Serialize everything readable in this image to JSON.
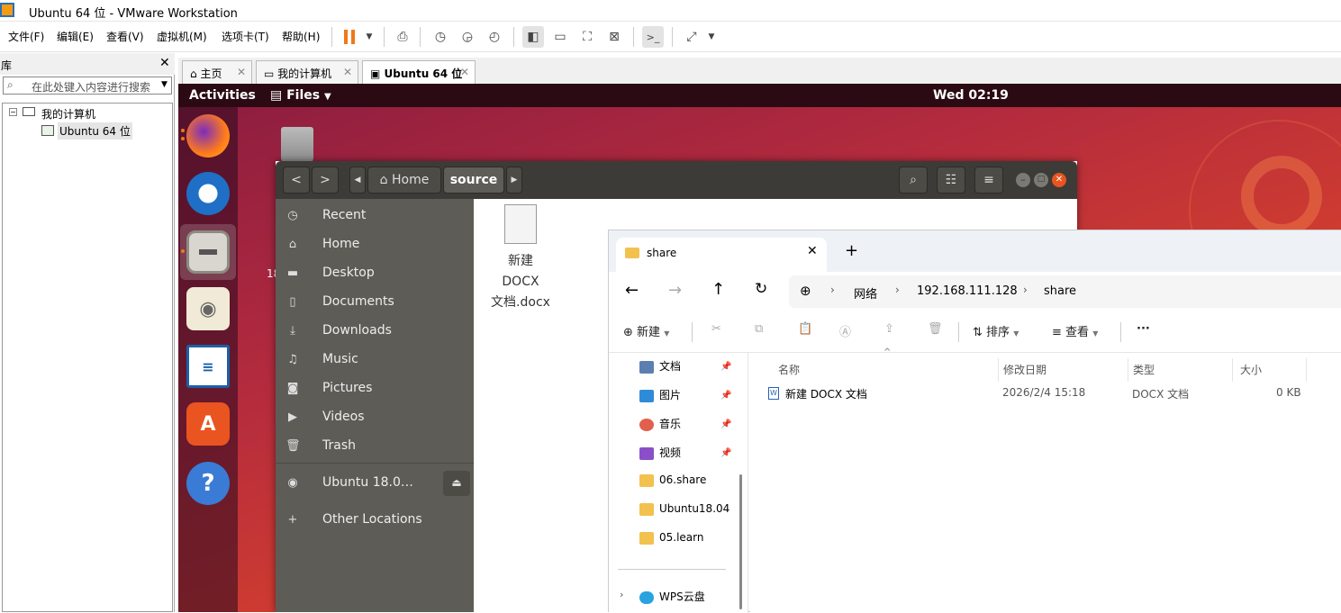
{
  "window": {
    "title": "Ubuntu 64 位 - VMware Workstation"
  },
  "menu": [
    "文件(F)",
    "编辑(E)",
    "查看(V)",
    "虚拟机(M)",
    "选项卡(T)",
    "帮助(H)"
  ],
  "library": {
    "title": "库",
    "search_placeholder": "在此处键入内容进行搜索",
    "tree_root": "我的计算机",
    "tree_child": "Ubuntu 64 位"
  },
  "tabs": [
    {
      "label": "主页"
    },
    {
      "label": "我的计算机"
    },
    {
      "label": "Ubuntu 64 位"
    }
  ],
  "ubuntu": {
    "activities": "Activities",
    "app_menu": "Files",
    "clock": "Wed 02:19",
    "desktop_partial_label": "18"
  },
  "nautilus": {
    "path_home": "Home",
    "path_current": "source",
    "sidebar": [
      {
        "label": "Recent",
        "icon": "clock-icon"
      },
      {
        "label": "Home",
        "icon": "home-icon"
      },
      {
        "label": "Desktop",
        "icon": "folder-icon"
      },
      {
        "label": "Documents",
        "icon": "document-icon"
      },
      {
        "label": "Downloads",
        "icon": "download-icon"
      },
      {
        "label": "Music",
        "icon": "music-icon"
      },
      {
        "label": "Pictures",
        "icon": "camera-icon"
      },
      {
        "label": "Videos",
        "icon": "video-icon"
      },
      {
        "label": "Trash",
        "icon": "trash-icon"
      }
    ],
    "device": "Ubuntu 18.0…",
    "other": "Other Locations",
    "file_line1": "新建 DOCX",
    "file_line2": "文档.docx"
  },
  "explorer": {
    "tab_title": "share",
    "breadcrumb": [
      "网络",
      "192.168.111.128",
      "share"
    ],
    "toolbar": {
      "new": "新建",
      "sort": "排序",
      "view": "查看",
      "more": "···"
    },
    "nav": [
      {
        "label": "文档",
        "pinned": true,
        "color": "#5b7fb0"
      },
      {
        "label": "图片",
        "pinned": true,
        "color": "#2e8bd8"
      },
      {
        "label": "音乐",
        "pinned": true,
        "color": "#e0604d"
      },
      {
        "label": "视频",
        "pinned": true,
        "color": "#8a4fc8"
      },
      {
        "label": "06.share",
        "pinned": false,
        "color": "#f2c14e"
      },
      {
        "label": "Ubuntu18.04",
        "pinned": false,
        "color": "#f2c14e"
      },
      {
        "label": "05.learn",
        "pinned": false,
        "color": "#f2c14e"
      }
    ],
    "cloud": "WPS云盘",
    "columns": [
      "名称",
      "修改日期",
      "类型",
      "大小"
    ],
    "files": [
      {
        "name": "新建 DOCX 文档",
        "date": "2026/2/4 15:18",
        "type": "DOCX 文档",
        "size": "0 KB"
      }
    ]
  }
}
